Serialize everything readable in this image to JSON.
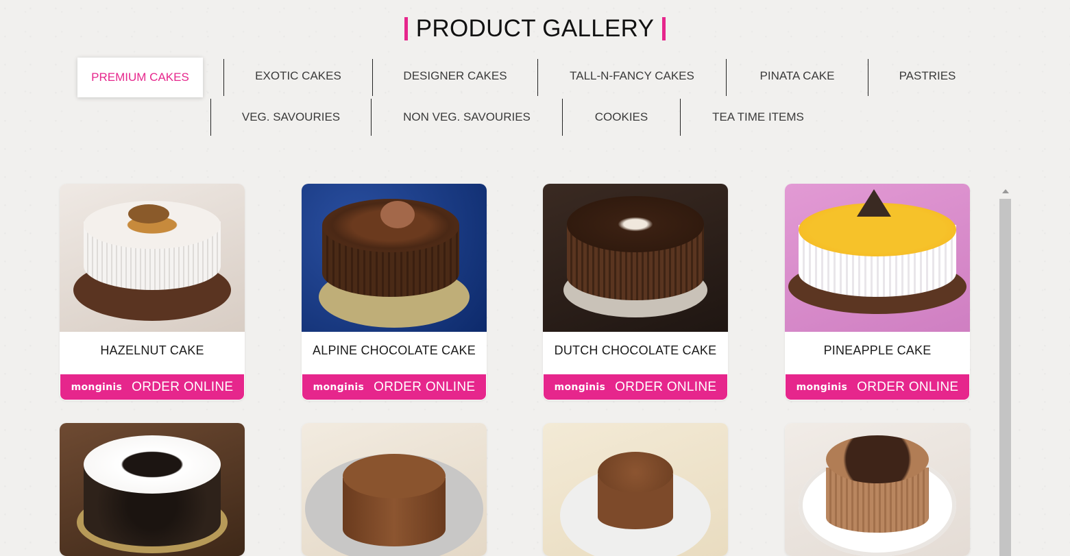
{
  "page_title": "PRODUCT GALLERY",
  "tabs_row1": [
    {
      "label": "PREMIUM CAKES",
      "active": true
    },
    {
      "label": "EXOTIC CAKES"
    },
    {
      "label": "DESIGNER CAKES"
    },
    {
      "label": "TALL-N-FANCY CAKES"
    },
    {
      "label": "PINATA CAKE"
    },
    {
      "label": "PASTRIES"
    }
  ],
  "tabs_row2": [
    {
      "label": "VEG. SAVOURIES"
    },
    {
      "label": "NON VEG. SAVOURIES"
    },
    {
      "label": "COOKIES"
    },
    {
      "label": "TEA TIME ITEMS"
    }
  ],
  "brand": "monginis",
  "order_label": "ORDER ONLINE",
  "products": [
    {
      "name": "HAZELNUT CAKE"
    },
    {
      "name": "ALPINE CHOCOLATE CAKE"
    },
    {
      "name": "DUTCH CHOCOLATE CAKE"
    },
    {
      "name": "PINEAPPLE CAKE"
    },
    {
      "name": ""
    },
    {
      "name": ""
    },
    {
      "name": ""
    },
    {
      "name": ""
    }
  ],
  "colors": {
    "accent": "#e6268c",
    "text": "#222222"
  }
}
